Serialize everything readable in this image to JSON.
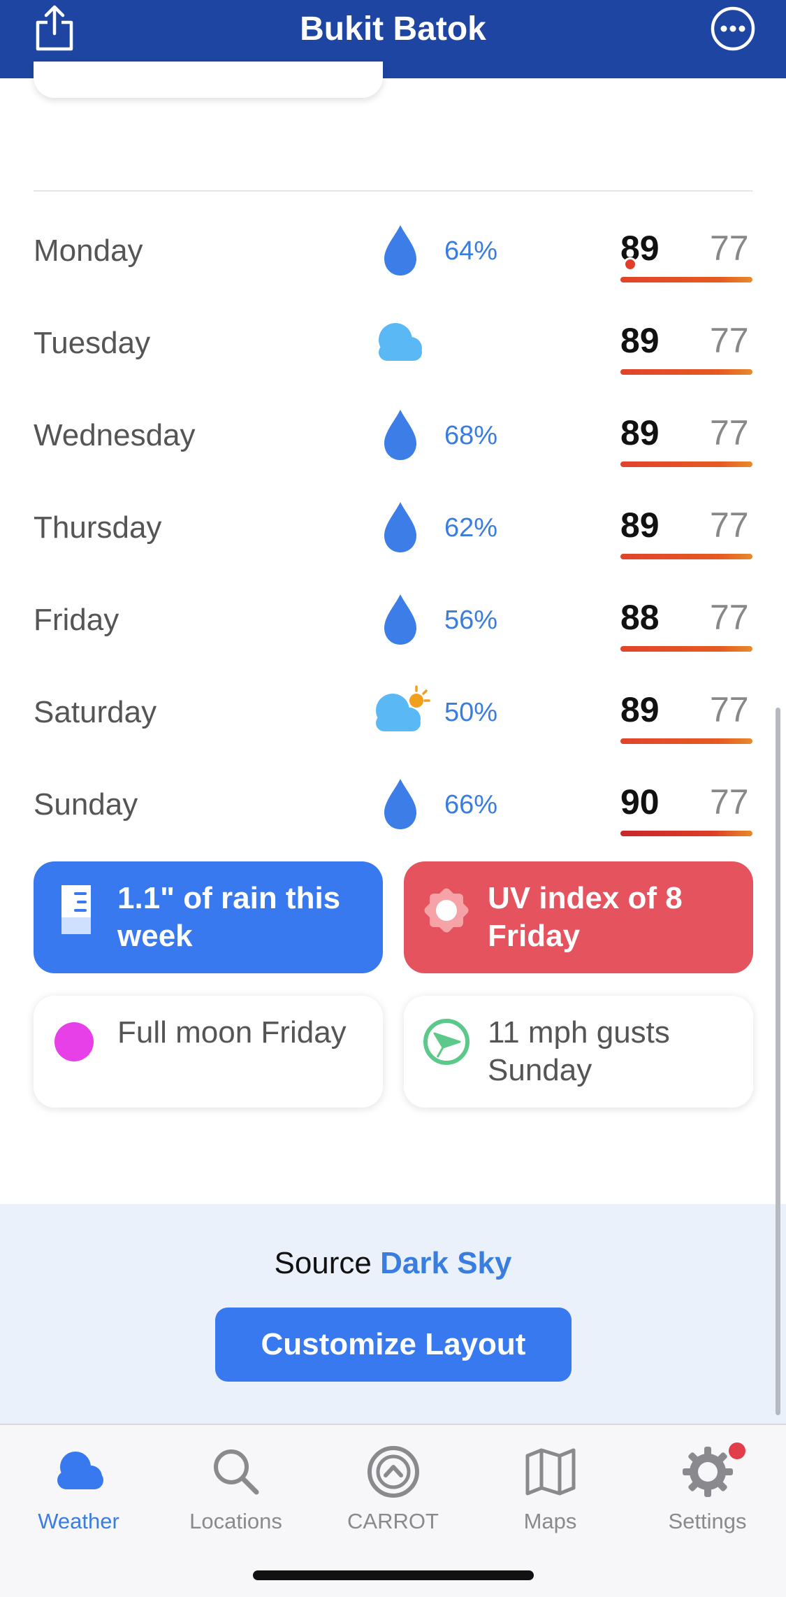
{
  "header": {
    "title": "Bukit Batok",
    "share_icon": "share-icon",
    "more_icon": "more-options-icon"
  },
  "forecast": [
    {
      "day": "Monday",
      "icon": "raindrop-icon",
      "precip": "64%",
      "high": "89",
      "low": "77"
    },
    {
      "day": "Tuesday",
      "icon": "cloud-icon",
      "precip": "",
      "high": "89",
      "low": "77"
    },
    {
      "day": "Wednesday",
      "icon": "raindrop-icon",
      "precip": "68%",
      "high": "89",
      "low": "77"
    },
    {
      "day": "Thursday",
      "icon": "raindrop-icon",
      "precip": "62%",
      "high": "89",
      "low": "77"
    },
    {
      "day": "Friday",
      "icon": "raindrop-icon",
      "precip": "56%",
      "high": "88",
      "low": "77"
    },
    {
      "day": "Saturday",
      "icon": "partly-cloudy-icon",
      "precip": "50%",
      "high": "89",
      "low": "77"
    },
    {
      "day": "Sunday",
      "icon": "raindrop-icon",
      "precip": "66%",
      "high": "90",
      "low": "77"
    }
  ],
  "cards": {
    "rain": "1.1\" of rain this week",
    "uv": "UV index of 8 Friday",
    "moon": "Full moon Friday",
    "wind": "11 mph gusts Sunday"
  },
  "source": {
    "prefix": "Source",
    "name": "Dark Sky"
  },
  "customize_label": "Customize Layout",
  "tabs": [
    {
      "label": "Weather",
      "icon": "cloud-icon",
      "active": true
    },
    {
      "label": "Locations",
      "icon": "search-icon",
      "active": false
    },
    {
      "label": "CARROT",
      "icon": "carrot-logo-icon",
      "active": false
    },
    {
      "label": "Maps",
      "icon": "map-icon",
      "active": false
    },
    {
      "label": "Settings",
      "icon": "gear-icon",
      "active": false
    }
  ],
  "colors": {
    "header_bg": "#1e45a1",
    "accent_blue": "#3879ef",
    "uv_red": "#e5535e",
    "precip_blue": "#3a7de0",
    "moon_magenta": "#e840e8",
    "wind_green": "#5cc98a"
  }
}
